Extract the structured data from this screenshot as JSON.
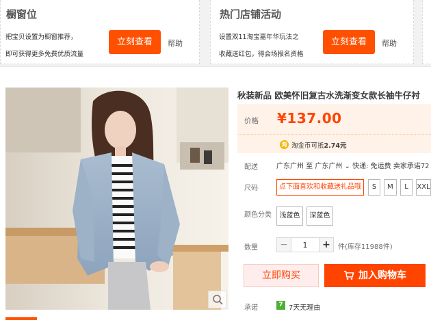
{
  "promos": [
    {
      "title": "橱窗位",
      "desc_line1": "把宝贝设置为橱窗推荐，",
      "desc_line2": "即可获得更多免费优质流量",
      "button": "立刻查看",
      "help": "帮助"
    },
    {
      "title": "热门店铺活动",
      "desc_line1": "设置双11淘宝嘉年华玩法之",
      "desc_line2": "收藏送红包，得会场报名资格",
      "button": "立刻查看",
      "help": "帮助"
    }
  ],
  "product": {
    "title": "秋装新品 欧美怀旧复古水洗渐变女款长袖牛仔衬",
    "price_label": "价格",
    "price": "¥137.00",
    "coin_icon": "淘",
    "coin_text_prefix": "淘金币可抵",
    "coin_amount": "2.74元",
    "shipping_label": "配送",
    "shipping_text": "广东广州 至 广东广州 ⌄ 快递: 免运费  卖家承诺72",
    "size_label": "尺码",
    "sizes": [
      "点下面喜欢和收藏送礼品哦",
      "S",
      "M",
      "L",
      "XXL"
    ],
    "color_label": "颜色分类",
    "colors": [
      "浅蓝色",
      "深蓝色"
    ],
    "qty_label": "数量",
    "qty_minus": "−",
    "qty_value": "1",
    "qty_plus": "+",
    "stock_text": "件(库存11988件)",
    "buy_now": "立即购买",
    "add_to_cart": "加入购物车",
    "promise_label": "承诺",
    "promise_icon": "7",
    "promise_text": "7天无理由"
  },
  "colors": {
    "accent": "#ff5000",
    "price": "#ff4400",
    "price_bg": "#fff2e8"
  },
  "icons": {
    "zoom": "magnifier-icon",
    "cart": "cart-icon",
    "coin": "taobao-coin-icon",
    "promise": "seven-day-return-icon"
  }
}
